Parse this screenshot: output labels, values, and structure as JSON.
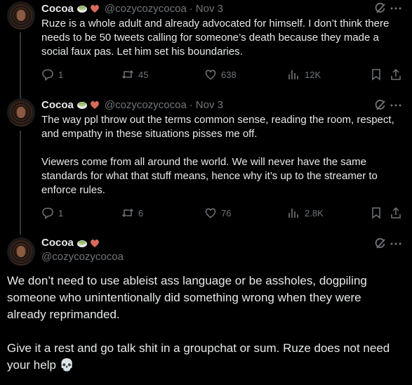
{
  "tweets": [
    {
      "name": "Cocoa",
      "handle": "@cozycozycocoa",
      "sep": "·",
      "time": "Nov 3",
      "text": "Ruze is a whole adult and already advocated for himself. I don’t think there needs to be 50 tweets calling for someone’s death because they made a social faux pas. Let him set his boundaries.",
      "replies": "1",
      "reposts": "45",
      "likes": "638",
      "views": "12K"
    },
    {
      "name": "Cocoa",
      "handle": "@cozycozycocoa",
      "sep": "·",
      "time": "Nov 3",
      "text": "The way ppl throw out the terms common sense, reading the room, respect, and empathy in these situations pisses me off.\n\nViewers come from all around the world. We will never have the same standards for what that stuff means, hence why it’s up to the streamer to enforce rules.",
      "replies": "1",
      "reposts": "6",
      "likes": "76",
      "views": "2.8K"
    }
  ],
  "main": {
    "name": "Cocoa",
    "handle": "@cozycozycocoa",
    "text": "We don’t need to use ableist ass language or be assholes, dogpiling someone who unintentionally did something wrong when they were already reprimanded.\n\nGive it a rest and go talk shit in a groupchat or sum. Ruze does not need your help 💀"
  },
  "icons": {
    "badge_matcha": "matcha-icon",
    "badge_heart": "heart-emoji-icon",
    "grok": "grok-icon",
    "more": "more-icon",
    "reply": "reply-icon",
    "repost": "repost-icon",
    "like": "like-icon",
    "views": "views-icon",
    "bookmark": "bookmark-icon",
    "share": "share-icon"
  },
  "colors": {
    "background": "#000000",
    "text": "#e7e9ea",
    "secondary": "#71767b",
    "heart": "#d86b5a",
    "matcha": "#a6c77a"
  }
}
